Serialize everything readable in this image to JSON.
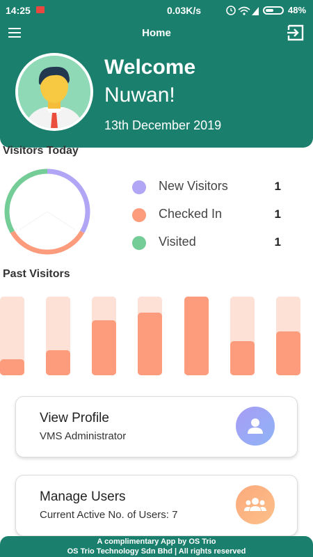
{
  "status_bar": {
    "time": "14:25",
    "network_speed": "0.03K/s",
    "battery": "48%"
  },
  "header": {
    "title": "Home",
    "welcome": "Welcome",
    "user_name": "Nuwan!",
    "date": "13th December 2019",
    "color": "#1b7f6d"
  },
  "visitors_today": {
    "title": "Visitors Today",
    "items": [
      {
        "label": "New Visitors",
        "value": "1",
        "color": "#b0a6f5"
      },
      {
        "label": "Checked In",
        "value": "1",
        "color": "#fc9c7c"
      },
      {
        "label": "Visited",
        "value": "1",
        "color": "#74cc97"
      }
    ]
  },
  "past_visitors": {
    "title": "Past Visitors"
  },
  "chart_data": {
    "type": "bar",
    "title": "Past Visitors",
    "categories": [
      "",
      "",
      "",
      "",
      "",
      "",
      ""
    ],
    "values": [
      0.2,
      0.32,
      0.7,
      0.8,
      1.0,
      0.43,
      0.56
    ],
    "ylim": [
      0,
      1
    ],
    "colors": {
      "fill": "#fc9c7c",
      "track": "#fde0d6"
    }
  },
  "cards": [
    {
      "title": "View Profile",
      "subtitle": "VMS Administrator",
      "icon": "person-icon"
    },
    {
      "title": "Manage Users",
      "subtitle": "Current Active No. of Users: 7",
      "icon": "group-icon"
    }
  ],
  "footer": {
    "line1": "A complimentary App by OS Trio",
    "line2": "OS Trio Technology Sdn Bhd | All rights reserved"
  }
}
